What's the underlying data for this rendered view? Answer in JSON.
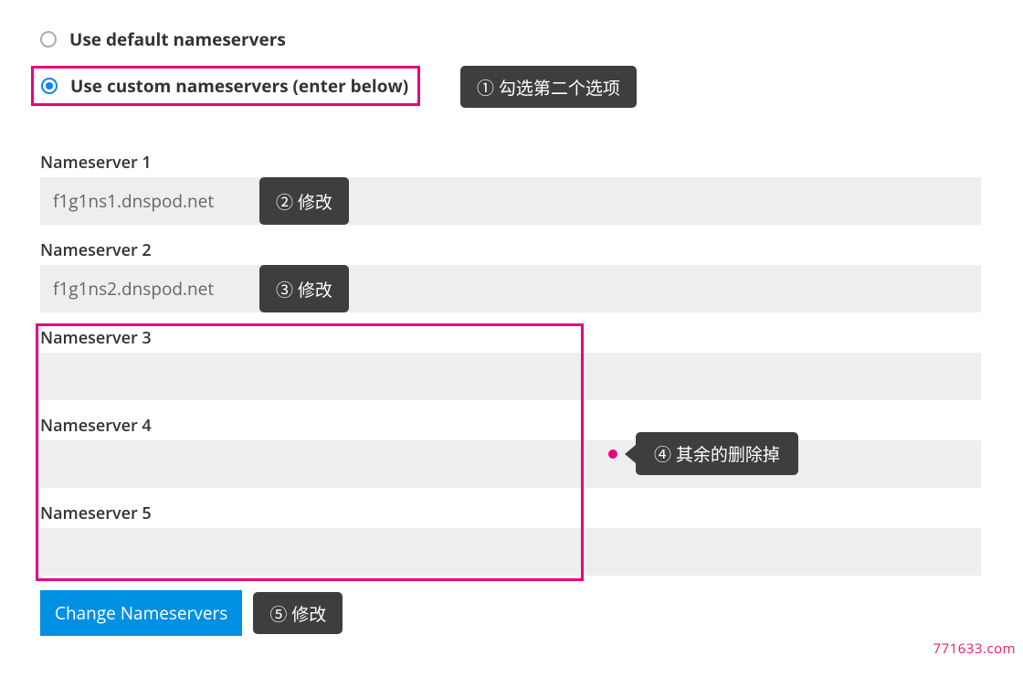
{
  "radios": {
    "default_label": "Use default nameservers",
    "custom_label": "Use custom nameservers (enter below)"
  },
  "annotations": {
    "a1": "① 勾选第二个选项",
    "a2": "② 修改",
    "a3": "③ 修改",
    "a4": "④ 其余的删除掉",
    "a5": "⑤ 修改"
  },
  "nameservers": {
    "ns1_label": "Nameserver 1",
    "ns1_value": "f1g1ns1.dnspod.net",
    "ns2_label": "Nameserver 2",
    "ns2_value": "f1g1ns2.dnspod.net",
    "ns3_label": "Nameserver 3",
    "ns3_value": "",
    "ns4_label": "Nameserver 4",
    "ns4_value": "",
    "ns5_label": "Nameserver 5",
    "ns5_value": ""
  },
  "buttons": {
    "change": "Change Nameservers"
  },
  "watermark": "771633.com"
}
